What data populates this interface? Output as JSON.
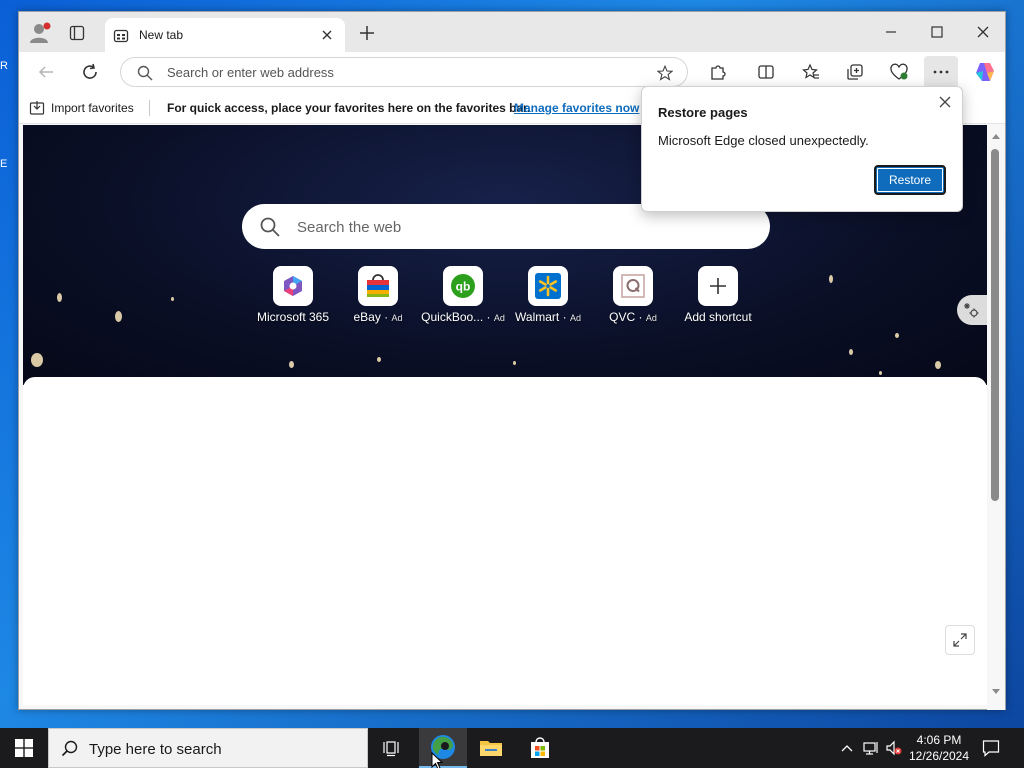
{
  "window": {
    "tab_title": "New tab"
  },
  "toolbar": {
    "address_placeholder": "Search or enter web address"
  },
  "favorites_bar": {
    "import_label": "Import favorites",
    "message": "For quick access, place your favorites here on the favorites bar.",
    "manage_link": "Manage favorites now"
  },
  "newtab": {
    "search_placeholder": "Search the web",
    "shortcuts": [
      {
        "name": "Microsoft 365",
        "ad": ""
      },
      {
        "name": "eBay",
        "ad": "Ad"
      },
      {
        "name": "QuickBoo...",
        "ad": "Ad"
      },
      {
        "name": "Walmart",
        "ad": "Ad"
      },
      {
        "name": "QVC",
        "ad": "Ad"
      },
      {
        "name": "Add shortcut",
        "ad": ""
      }
    ]
  },
  "popup": {
    "title": "Restore pages",
    "message": "Microsoft Edge closed unexpectedly.",
    "restore_button": "Restore"
  },
  "taskbar": {
    "search_text": "Type here to search",
    "time": "4:06 PM",
    "date": "12/26/2024"
  },
  "desktop_fragments": [
    "R",
    "E"
  ],
  "colors": {
    "accent": "#0f6cbd",
    "desktop": "#1e88e5",
    "taskbar": "#1b1b1d"
  }
}
